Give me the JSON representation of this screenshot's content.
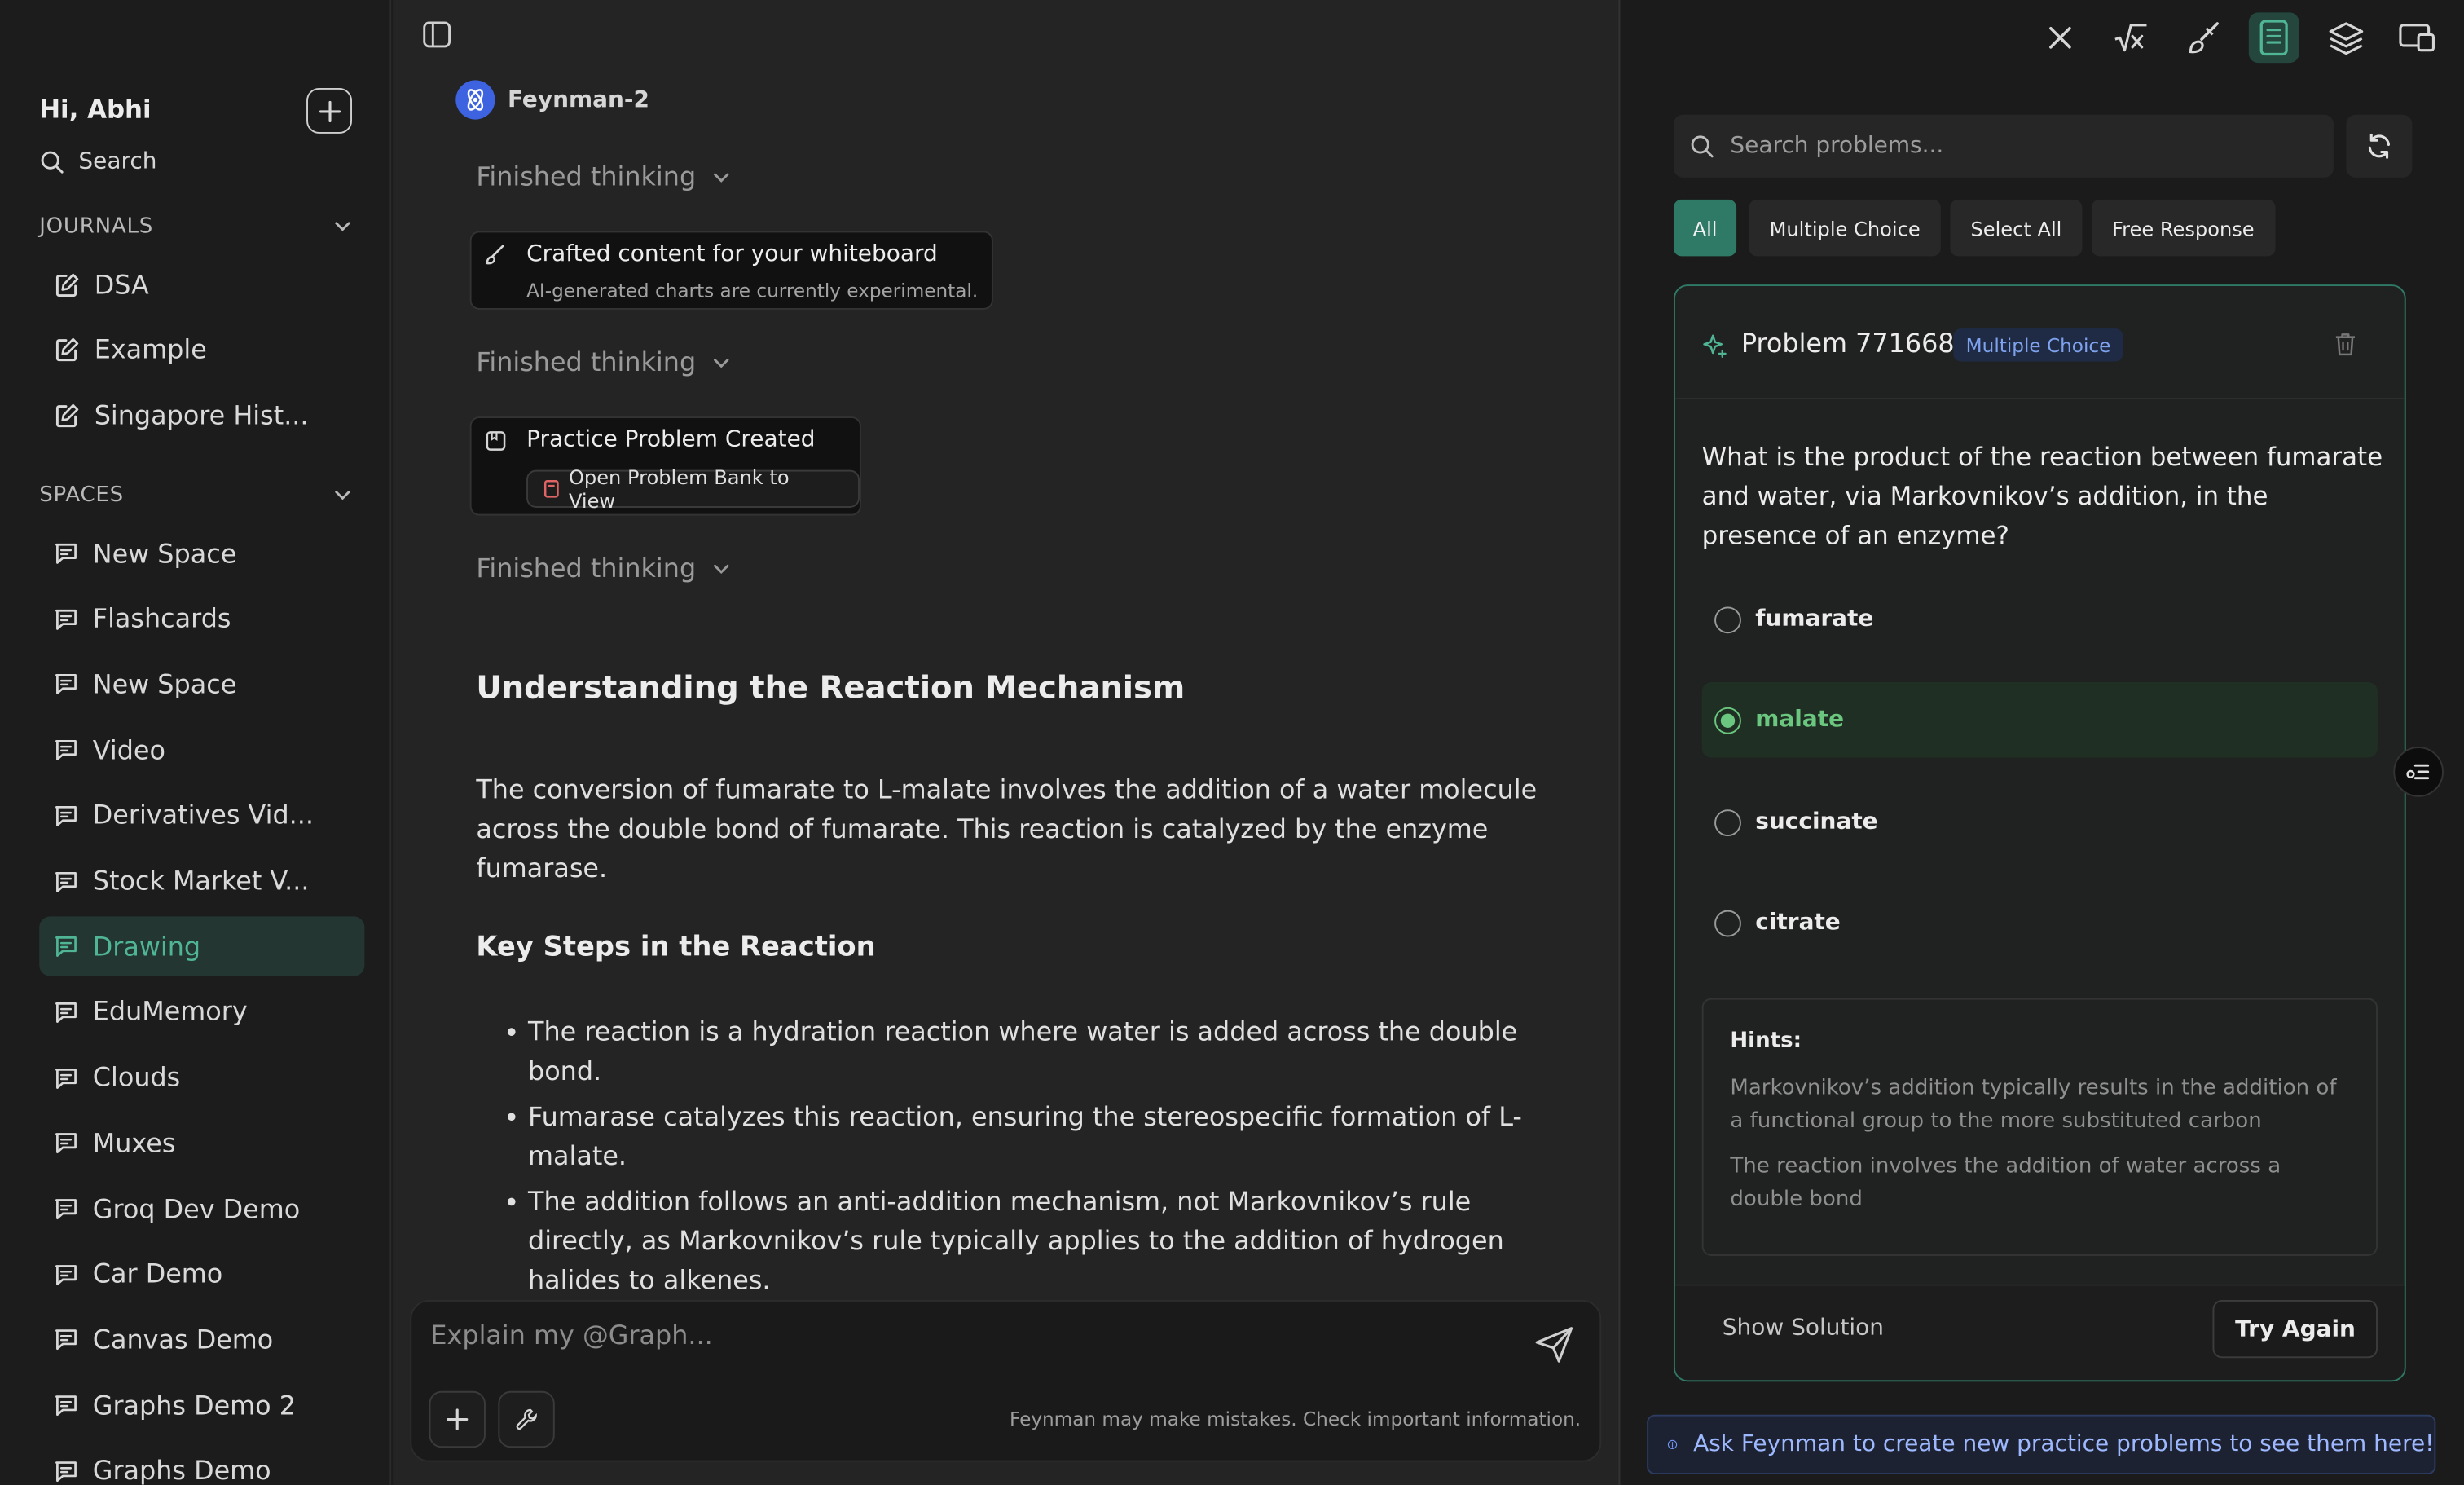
{
  "sidebar": {
    "greeting": "Hi, Abhi",
    "search_label": "Search",
    "journals_header": "JOURNALS",
    "journals": [
      {
        "label": "DSA"
      },
      {
        "label": "Example"
      },
      {
        "label": "Singapore Hist..."
      }
    ],
    "spaces_header": "SPACES",
    "spaces": [
      {
        "label": "New Space"
      },
      {
        "label": "Flashcards"
      },
      {
        "label": "New Space"
      },
      {
        "label": "Video"
      },
      {
        "label": "Derivatives Vid..."
      },
      {
        "label": "Stock Market V..."
      },
      {
        "label": "Drawing",
        "active": true
      },
      {
        "label": "EduMemory"
      },
      {
        "label": "Clouds"
      },
      {
        "label": "Muxes"
      },
      {
        "label": "Groq Dev Demo"
      },
      {
        "label": "Car Demo"
      },
      {
        "label": "Canvas Demo"
      },
      {
        "label": "Graphs Demo 2"
      },
      {
        "label": "Graphs Demo"
      }
    ]
  },
  "chat": {
    "bot_name": "Feynman-2",
    "thinking_1": "Finished thinking",
    "tool_1_title": "Crafted content for your whiteboard",
    "tool_1_sub": "AI-generated charts are currently experimental.",
    "thinking_2": "Finished thinking",
    "tool_2_title": "Practice Problem Created",
    "tool_2_button": "Open Problem Bank to View",
    "thinking_3": "Finished thinking",
    "heading": "Understanding the Reaction Mechanism",
    "paragraph": "The conversion of fumarate to L-malate involves the addition of a water molecule across the double bond of fumarate. This reaction is catalyzed by the enzyme fumarase.",
    "subheading": "Key Steps in the Reaction",
    "bullets": [
      "The reaction is a hydration reaction where water is added across the double bond.",
      "Fumarase catalyzes this reaction, ensuring the stereospecific formation of L-malate.",
      "The addition follows an anti-addition mechanism, not Markovnikov’s rule directly, as Markovnikov’s rule typically applies to the addition of hydrogen halides to alkenes."
    ],
    "composer_placeholder": "Explain my @Graph...",
    "disclaimer": "Feynman may make mistakes. Check important information."
  },
  "problems": {
    "search_placeholder": "Search problems...",
    "filters": [
      "All",
      "Multiple Choice",
      "Select All",
      "Free Response"
    ],
    "active_filter": "All",
    "card": {
      "title": "Problem 771668",
      "badge": "Multiple Choice",
      "question": "What is the product of the reaction between fumarate and water, via Markovnikov’s addition, in the presence of an enzyme?",
      "options": [
        {
          "label": "fumarate",
          "selected": false
        },
        {
          "label": "malate",
          "selected": true
        },
        {
          "label": "succinate",
          "selected": false
        },
        {
          "label": "citrate",
          "selected": false
        }
      ],
      "hints_title": "Hints:",
      "hints": [
        "Markovnikov’s addition typically results in the addition of a functional group to the more substituted carbon",
        "The reaction involves the addition of water across a double bond"
      ],
      "show_solution": "Show Solution",
      "try_again": "Try Again"
    },
    "info": "Ask Feynman to create new practice problems to see them here!"
  },
  "colors": {
    "accent": "#2f7a66",
    "active_nav_text": "#4fb594",
    "selected_option": "#6bc77f",
    "info_text": "#9db8ff",
    "badge_text": "#7ea2ee"
  },
  "icons": {
    "toolbar": [
      "close-icon",
      "formula-icon",
      "brush-icon",
      "notebook-icon",
      "layers-icon",
      "screens-icon"
    ],
    "active_toolbar": "notebook-icon"
  }
}
